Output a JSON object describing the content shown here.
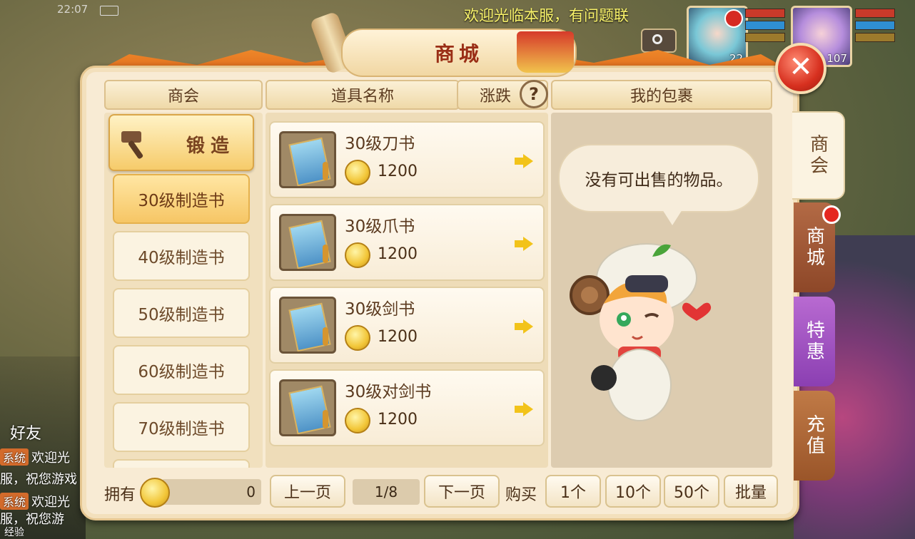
{
  "status": {
    "time": "22:07"
  },
  "marquee": "欢迎光临本服，有问题联",
  "portraits": [
    {
      "level": "22"
    },
    {
      "level": "107"
    }
  ],
  "panel": {
    "title": "商城",
    "close_label": "✕"
  },
  "headers": {
    "guild": "商会",
    "item_name": "道具名称",
    "change": "涨跌",
    "help": "?",
    "bag": "我的包裹"
  },
  "forge": {
    "label": "锻造"
  },
  "categories": [
    {
      "label": "30级制造书"
    },
    {
      "label": "40级制造书"
    },
    {
      "label": "50级制造书"
    },
    {
      "label": "60级制造书"
    },
    {
      "label": "70级制造书"
    }
  ],
  "items": [
    {
      "name": "30级刀书",
      "price": "1200"
    },
    {
      "name": "30级爪书",
      "price": "1200"
    },
    {
      "name": "30级剑书",
      "price": "1200"
    },
    {
      "name": "30级对剑书",
      "price": "1200"
    }
  ],
  "bag": {
    "empty_message": "没有可出售的物品。"
  },
  "tabs": {
    "shop": "商会",
    "mall": "商城",
    "deal": "特惠",
    "charge": "充值"
  },
  "bottom": {
    "own_label": "拥有",
    "own_amount": "0",
    "prev_page": "上一页",
    "page": "1/8",
    "next_page": "下一页",
    "buy_label": "购买",
    "qty_1": "1个",
    "qty_10": "10个",
    "qty_50": "50个",
    "bulk": "批量"
  },
  "chat": {
    "friends": "好友",
    "lines": [
      {
        "tag": "系统",
        "text": "欢迎光"
      },
      {
        "tag": "",
        "text": "服，祝您游戏"
      },
      {
        "tag": "系统",
        "text": "欢迎光"
      },
      {
        "tag": "",
        "text": "服，祝您游"
      }
    ],
    "exp": "经验"
  },
  "colors": {
    "panel_bg": "#f8ebd4",
    "accent_gold": "#f6c665",
    "close_red": "#d7301f",
    "tab_purple": "#8b3fb2"
  }
}
